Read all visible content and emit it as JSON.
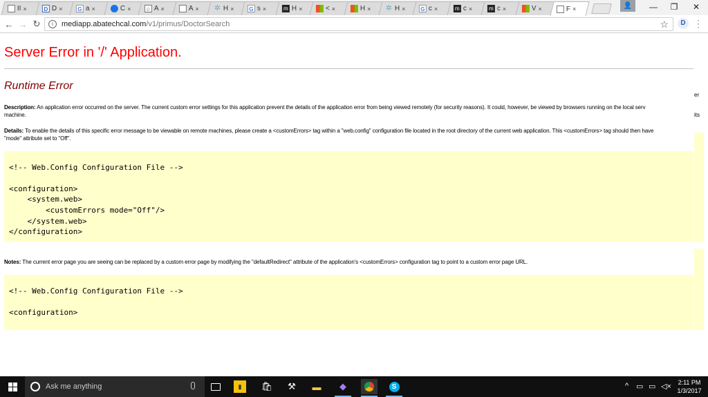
{
  "browser": {
    "tabs": [
      {
        "favicon": "doc-icon",
        "label": "II",
        "active": false
      },
      {
        "favicon": "d-icon",
        "label": "D",
        "active": false
      },
      {
        "favicon": "g-icon",
        "label": "a",
        "active": false
      },
      {
        "favicon": "circle-icon",
        "label": "C",
        "active": false
      },
      {
        "favicon": "person-icon",
        "label": "A",
        "active": false
      },
      {
        "favicon": "doc-icon",
        "label": "A",
        "active": false
      },
      {
        "favicon": "star-icon",
        "label": "H",
        "active": false
      },
      {
        "favicon": "g-icon",
        "label": "s",
        "active": false
      },
      {
        "favicon": "m-icon",
        "label": "H",
        "active": false
      },
      {
        "favicon": "ms-icon",
        "label": "<",
        "active": false
      },
      {
        "favicon": "ms-icon",
        "label": "H",
        "active": false
      },
      {
        "favicon": "star-icon",
        "label": "H",
        "active": false
      },
      {
        "favicon": "g-icon",
        "label": "c",
        "active": false
      },
      {
        "favicon": "m-icon",
        "label": "c",
        "active": false
      },
      {
        "favicon": "m-icon",
        "label": "c",
        "active": false
      },
      {
        "favicon": "ms-icon",
        "label": "V",
        "active": false
      },
      {
        "favicon": "doc-icon",
        "label": "F",
        "active": true
      }
    ],
    "tab_close": "×",
    "url_host": "mediapp.abatechcal.com",
    "url_path": "/v1/primus/DoctorSearch",
    "controls": {
      "minimize": "—",
      "restore": "❐",
      "close": "✕"
    }
  },
  "page": {
    "title": "Server Error in '/' Application.",
    "subtitle": "Runtime Error",
    "description_label": "Description:",
    "description_text": "An application error occurred on the server. The current custom error settings for this application prevent the details of the application error from being viewed remotely (for security reasons). It could, however, be viewed by browsers running on the local serv",
    "description_text_2": "machine.",
    "overflow_1": "er",
    "overflow_2": "its",
    "details_label": "Details:",
    "details_text": "To enable the details of this specific error message to be viewable on remote machines, please create a <customErrors> tag within a \"web.config\" configuration file located in the root directory of the current web application. This <customErrors> tag should then have",
    "details_text_2": "\"mode\" attribute set to \"Off\".",
    "code_1": "\n<!-- Web.Config Configuration File -->\n\n<configuration>\n    <system.web>\n        <customErrors mode=\"Off\"/>\n    </system.web>\n</configuration>",
    "notes_label": "Notes:",
    "notes_text": "The current error page you are seeing can be replaced by a custom error page by modifying the \"defaultRedirect\" attribute of the application's <customErrors> configuration tag to point to a custom error page URL.",
    "code_2": "\n<!-- Web.Config Configuration File -->\n\n<configuration>"
  },
  "taskbar": {
    "search_placeholder": "Ask me anything",
    "time": "2:11 PM",
    "date": "1/3/2017",
    "accent": "#76b9ed"
  }
}
